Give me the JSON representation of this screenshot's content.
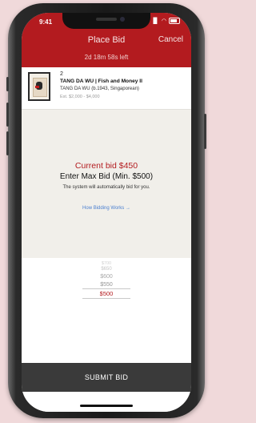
{
  "status_bar": {
    "time": "9:41"
  },
  "header": {
    "title": "Place Bid",
    "cancel_label": "Cancel",
    "time_left": "2d 18m 58s left"
  },
  "lot": {
    "number": "2",
    "title": "TANG DA WU | Fish and Money II",
    "artist": "TANG DA WU (b.1943, Singaporean)",
    "estimate": "Est. $2,000 - $4,000"
  },
  "bid": {
    "current_bid": "Current bid $450",
    "enter_max": "Enter Max Bid (Min. $500)",
    "auto_note": "The system will automatically bid for you.",
    "how_link": "How Bidding Works →"
  },
  "picker": {
    "options": [
      "$700",
      "$650",
      "$600",
      "$550",
      "$500"
    ],
    "selected": "$500"
  },
  "submit_label": "SUBMIT BID",
  "colors": {
    "brand_red": "#b31b1f",
    "submit_bg": "#3a3a3a",
    "link_blue": "#4a7fd0"
  }
}
